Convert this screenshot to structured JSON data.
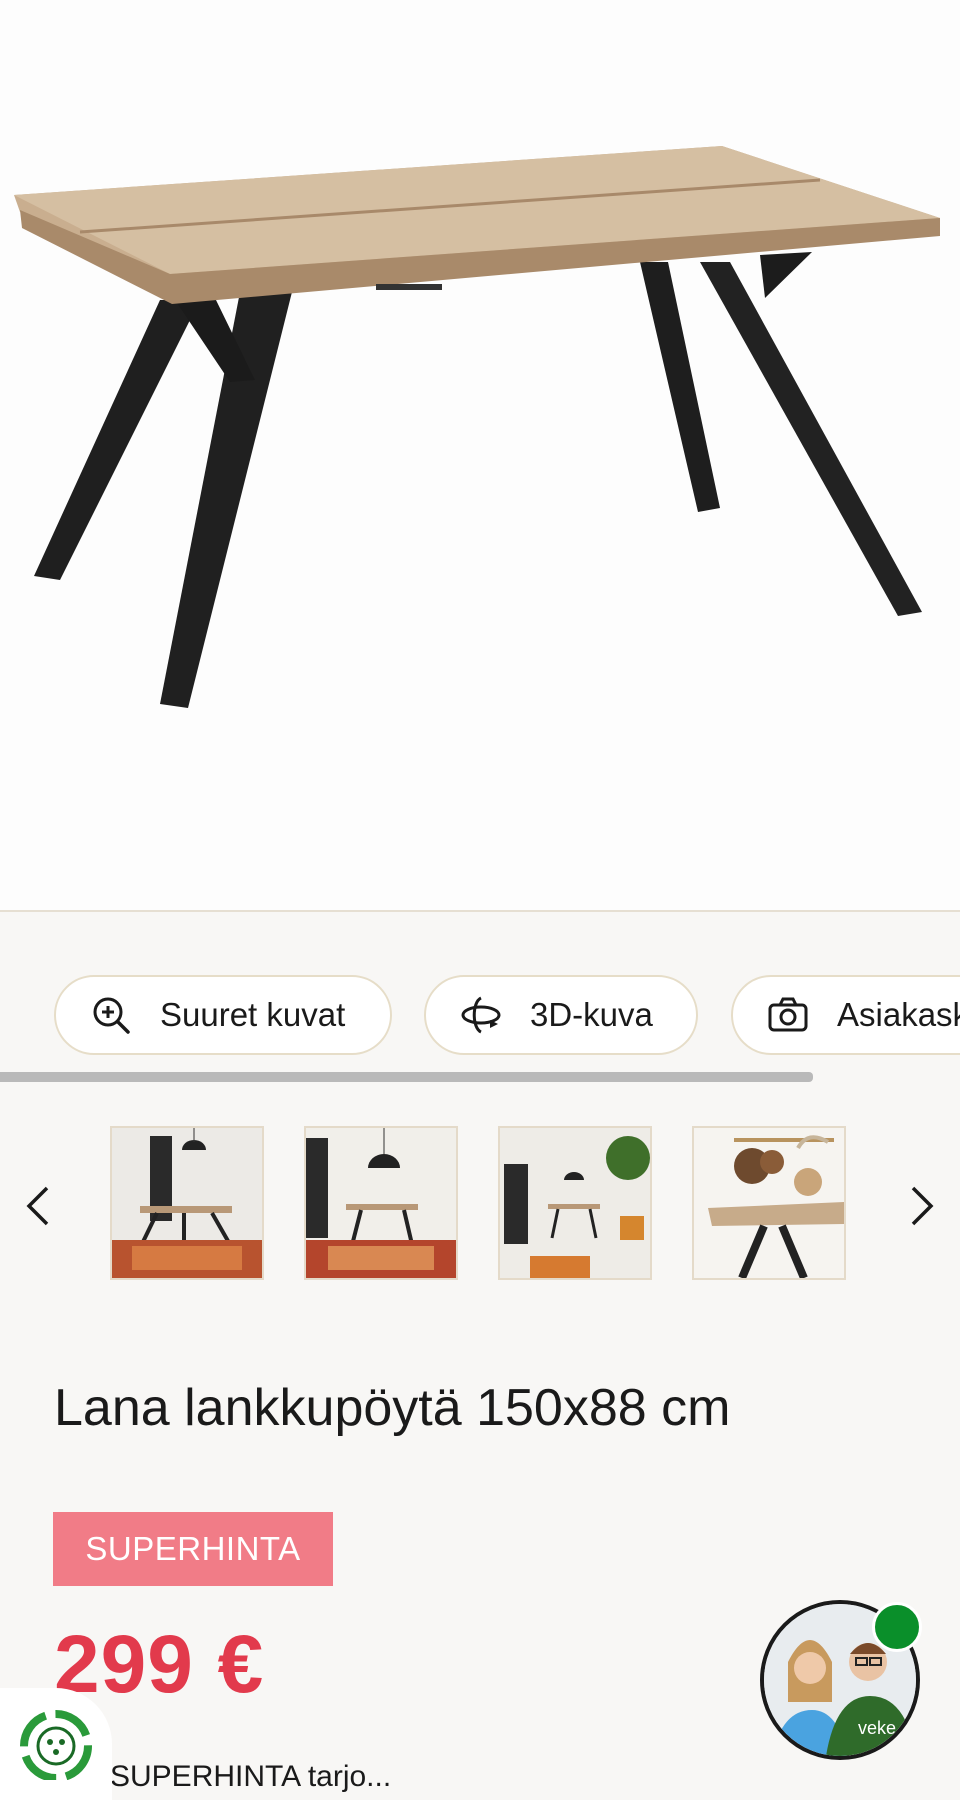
{
  "product_image": {
    "alt": "Lana lankkupöytä"
  },
  "actions": [
    {
      "label": "Suuret kuvat",
      "icon": "zoom-in-icon"
    },
    {
      "label": "3D-kuva",
      "icon": "rotate-3d-icon"
    },
    {
      "label": "Asiakask",
      "icon": "camera-icon"
    }
  ],
  "carousel": {
    "prev_icon": "chevron-left-icon",
    "next_icon": "chevron-right-icon",
    "thumbnails": [
      "interior-thumbnail-1",
      "interior-thumbnail-2",
      "interior-thumbnail-3",
      "interior-thumbnail-4"
    ]
  },
  "product": {
    "title": "Lana lankkupöytä 150x88 cm",
    "badge": "SUPERHINTA",
    "price": "299 €",
    "price_note": "SUPERHINTA tarjo..."
  },
  "colors": {
    "badge": "#f17c87",
    "price": "#e23a4c",
    "online": "#0a8f2a"
  },
  "chat": {
    "brand": "veke"
  }
}
